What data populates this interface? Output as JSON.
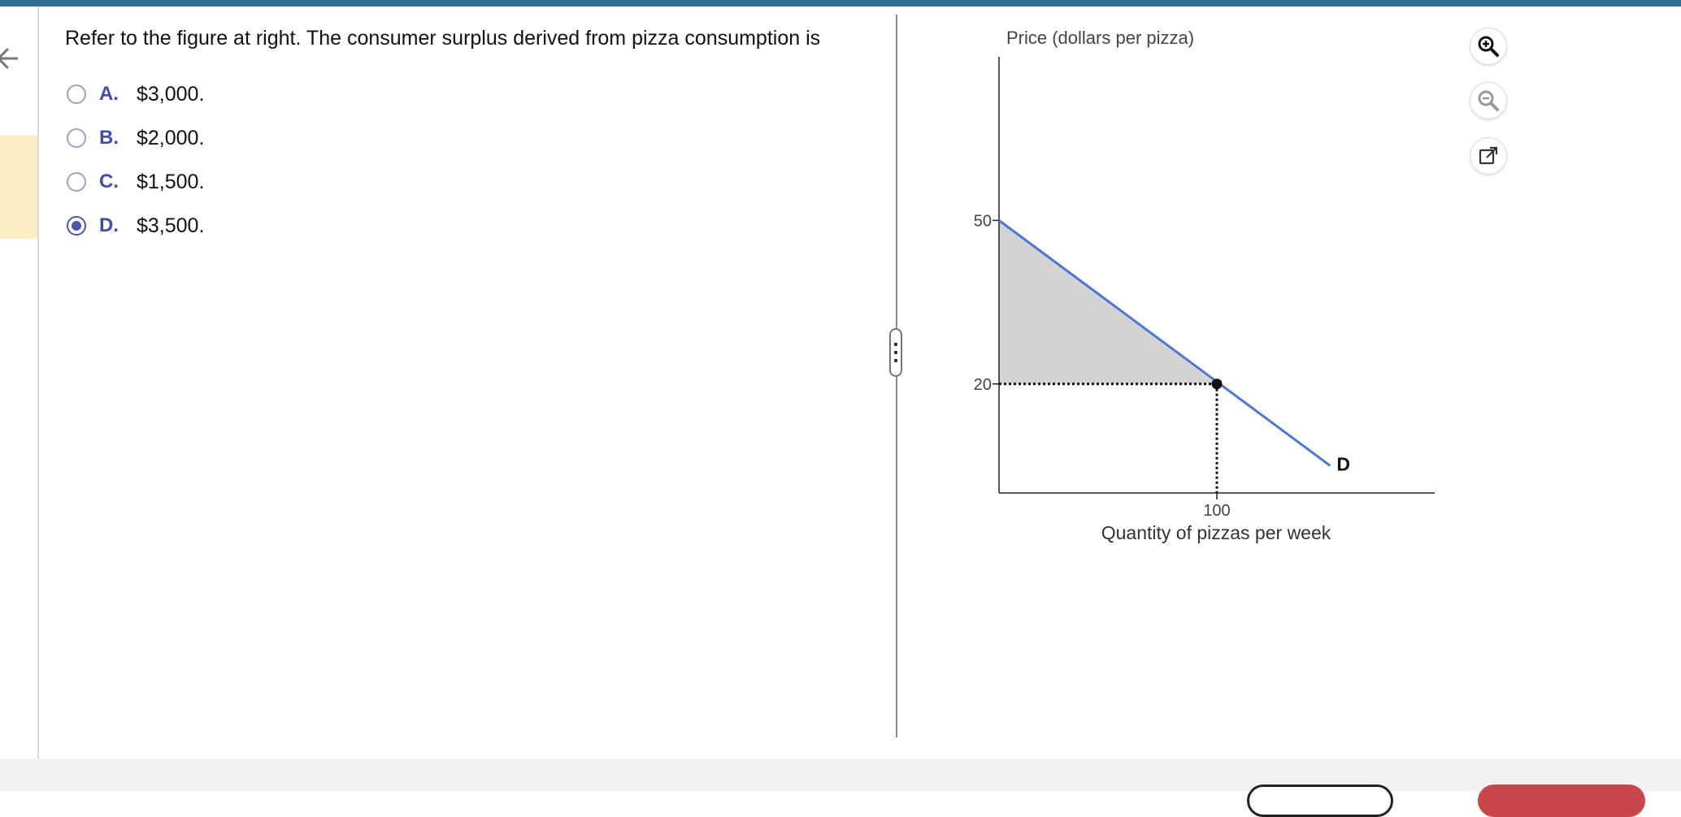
{
  "question": {
    "prompt": "Refer to the figure at right. The consumer surplus derived from pizza consumption is"
  },
  "choices": [
    {
      "letter": "A.",
      "text": "$3,000.",
      "selected": false
    },
    {
      "letter": "B.",
      "text": "$2,000.",
      "selected": false
    },
    {
      "letter": "C.",
      "text": "$1,500.",
      "selected": false
    },
    {
      "letter": "D.",
      "text": "$3,500.",
      "selected": true
    }
  ],
  "colors": {
    "accent": "#3f4fa8",
    "top_bar": "#2f6d8e",
    "demand_line": "#4a76d4",
    "shaded_area": "#d3d3d3",
    "highlight": "#fbeec7"
  },
  "chart_data": {
    "type": "line",
    "ylabel": "Price (dollars per pizza)",
    "xlabel": "Quantity of pizzas per week",
    "x_ticks": [
      {
        "value": 100,
        "label": "100"
      }
    ],
    "y_ticks": [
      {
        "value": 20,
        "label": "20"
      },
      {
        "value": 50,
        "label": "50"
      }
    ],
    "xlim": [
      0,
      200
    ],
    "ylim": [
      0,
      80
    ],
    "series": [
      {
        "name": "D",
        "x": [
          0,
          152
        ],
        "y": [
          50,
          5
        ]
      }
    ],
    "equilibrium": {
      "x": 100,
      "y": 20
    },
    "shaded_region": {
      "points": [
        [
          0,
          50
        ],
        [
          0,
          20
        ],
        [
          100,
          20
        ]
      ]
    },
    "grid": false
  },
  "tools": {
    "zoom_in": "zoom-in-icon",
    "zoom_out": "zoom-out-icon",
    "popout": "external-link-icon"
  }
}
